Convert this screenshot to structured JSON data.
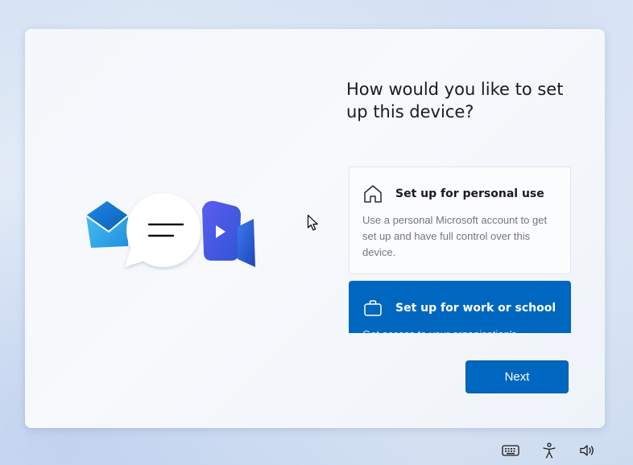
{
  "setup": {
    "heading": "How would you like to set up this device?",
    "options": [
      {
        "icon": "home-icon",
        "title": "Set up for personal use",
        "description": "Use a personal Microsoft account to get set up and have full control over this device.",
        "selected": false
      },
      {
        "icon": "briefcase-icon",
        "title": "Set up for work or school",
        "description": "Get access to your organisation's",
        "selected": true
      }
    ],
    "next_label": "Next"
  },
  "illustration": {
    "icons": [
      "mail-icon",
      "chat-bubble-icon",
      "video-call-icon"
    ]
  },
  "taskbar": {
    "icons": [
      "keyboard-icon",
      "accessibility-icon",
      "volume-icon"
    ]
  },
  "colors": {
    "accent": "#0067c0",
    "heading_text": "#1b1b1b",
    "secondary_text": "#767676"
  }
}
